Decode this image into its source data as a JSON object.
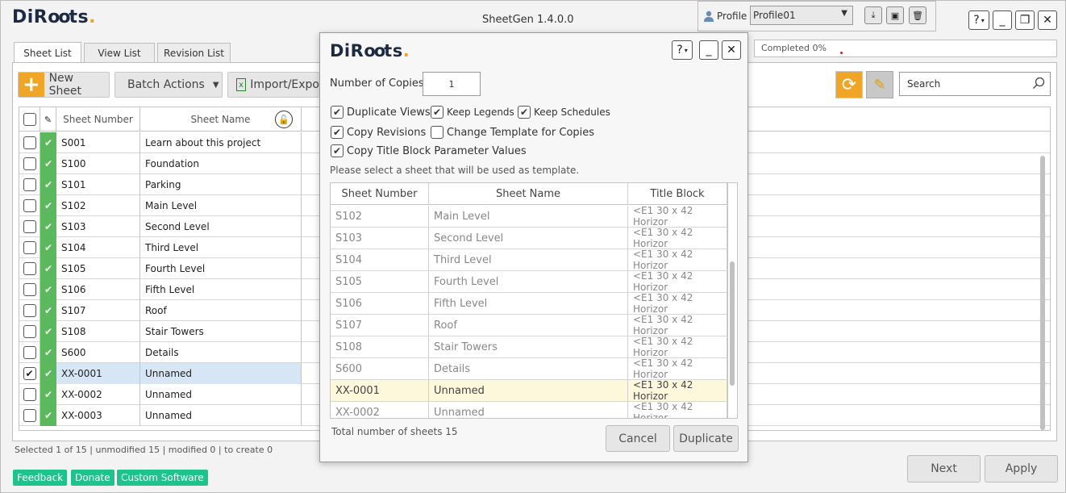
{
  "app": {
    "logo_text": "DiRoots",
    "title": "SheetGen 1.4.0.0",
    "help_label": "?",
    "minimize_label": "_",
    "restore_label": "❐",
    "close_label": "✕"
  },
  "profile": {
    "label": "Profile",
    "value": "Profile01"
  },
  "progress": {
    "text": "Completed 0%",
    "value": 0
  },
  "tabs": [
    {
      "label": "Sheet List"
    },
    {
      "label": "View List"
    },
    {
      "label": "Revision List"
    }
  ],
  "toolbar": {
    "new_sheet": "New Sheet",
    "batch_actions": "Batch Actions",
    "import_export": "Import/Expo",
    "search_placeholder": "Search"
  },
  "sheet_grid": {
    "col_number": "Sheet Number",
    "col_name": "Sheet Name",
    "rows": [
      {
        "number": "S001",
        "name": "Learn about this project",
        "checked": false
      },
      {
        "number": "S100",
        "name": "Foundation",
        "checked": false
      },
      {
        "number": "S101",
        "name": "Parking",
        "checked": false
      },
      {
        "number": "S102",
        "name": "Main Level",
        "checked": false
      },
      {
        "number": "S103",
        "name": "Second Level",
        "checked": false
      },
      {
        "number": "S104",
        "name": "Third Level",
        "checked": false
      },
      {
        "number": "S105",
        "name": "Fourth Level",
        "checked": false
      },
      {
        "number": "S106",
        "name": "Fifth Level",
        "checked": false
      },
      {
        "number": "S107",
        "name": "Roof",
        "checked": false
      },
      {
        "number": "S108",
        "name": "Stair Towers",
        "checked": false
      },
      {
        "number": "S600",
        "name": "Details",
        "checked": false
      },
      {
        "number": "XX-0001",
        "name": "Unnamed",
        "checked": true
      },
      {
        "number": "XX-0002",
        "name": "Unnamed",
        "checked": false
      },
      {
        "number": "XX-0003",
        "name": "Unnamed",
        "checked": false
      }
    ]
  },
  "status_line": "Selected 1 of 15 | unmodified 15 | modified 0 | to create 0",
  "footer": {
    "feedback": "Feedback",
    "donate": "Donate",
    "custom_software": "Custom Software",
    "next": "Next",
    "apply": "Apply"
  },
  "dialog": {
    "logo_text": "DiRoots",
    "copies_label": "Number of Copies",
    "copies_value": "1",
    "opt_duplicate_views": "Duplicate Views",
    "opt_keep_legends": "Keep Legends",
    "opt_keep_schedules": "Keep Schedules",
    "opt_copy_revisions": "Copy Revisions",
    "opt_change_template": "Change Template for Copies",
    "opt_copy_title_block": "Copy Title Block Parameter Values",
    "instruction": "Please select a sheet that will be used as template.",
    "col_number": "Sheet Number",
    "col_name": "Sheet Name",
    "col_title_block": "Title Block",
    "rows": [
      {
        "number": "S102",
        "name": "Main Level",
        "tb": "<E1 30 x 42 Horizor"
      },
      {
        "number": "S103",
        "name": "Second Level",
        "tb": "<E1 30 x 42 Horizor"
      },
      {
        "number": "S104",
        "name": "Third Level",
        "tb": "<E1 30 x 42 Horizor"
      },
      {
        "number": "S105",
        "name": "Fourth Level",
        "tb": "<E1 30 x 42 Horizor"
      },
      {
        "number": "S106",
        "name": "Fifth Level",
        "tb": "<E1 30 x 42 Horizor"
      },
      {
        "number": "S107",
        "name": "Roof",
        "tb": "<E1 30 x 42 Horizor"
      },
      {
        "number": "S108",
        "name": "Stair Towers",
        "tb": "<E1 30 x 42 Horizor"
      },
      {
        "number": "S600",
        "name": "Details",
        "tb": "<E1 30 x 42 Horizor"
      },
      {
        "number": "XX-0001",
        "name": "Unnamed",
        "tb": "<E1 30 x 42 Horizor"
      },
      {
        "number": "XX-0002",
        "name": "Unnamed",
        "tb": "<E1 30 x 42 Horizor"
      }
    ],
    "total": "Total number of sheets 15",
    "cancel": "Cancel",
    "duplicate": "Duplicate"
  },
  "colors": {
    "accent_orange": "#f0a526",
    "status_green": "#5cb85c",
    "footer_teal": "#1ec28b",
    "selected_row": "#d7e6f4",
    "dialog_selected_row": "#fdf7dc"
  },
  "icons": [
    "plus-icon",
    "chevron-down-icon",
    "excel-icon",
    "refresh-icon",
    "broom-icon",
    "search-icon",
    "pencil-icon",
    "lock-icon",
    "user-icon",
    "save-icon",
    "trash-icon",
    "download-icon"
  ]
}
